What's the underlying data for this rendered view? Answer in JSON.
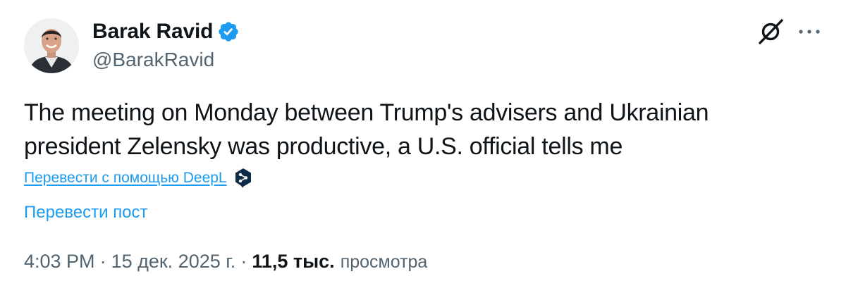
{
  "author": {
    "name": "Barak Ravid",
    "handle": "@BarakRavid",
    "verified": true
  },
  "tweet": {
    "text_lines": [
      "The meeting on Monday between Trump's advisers and Ukrainian",
      "president Zelensky was productive, a U.S. official tells me"
    ]
  },
  "translate": {
    "deepl_label": "Перевести с помощью DeepL",
    "post_label": "Перевести пост"
  },
  "meta": {
    "time": "4:03 PM",
    "separator": "·",
    "date": "15 дек. 2025 г.",
    "views_count": "11,5 тыс.",
    "views_label": "просмотра"
  },
  "icons": {
    "verified": "verified-badge-icon",
    "grok": "grok-icon",
    "more": "more-options-icon",
    "deepl": "deepl-icon"
  },
  "colors": {
    "accent": "#1d9bf0",
    "text": "#0f1419",
    "secondary": "#536471",
    "deepl": "#0f2b46"
  }
}
